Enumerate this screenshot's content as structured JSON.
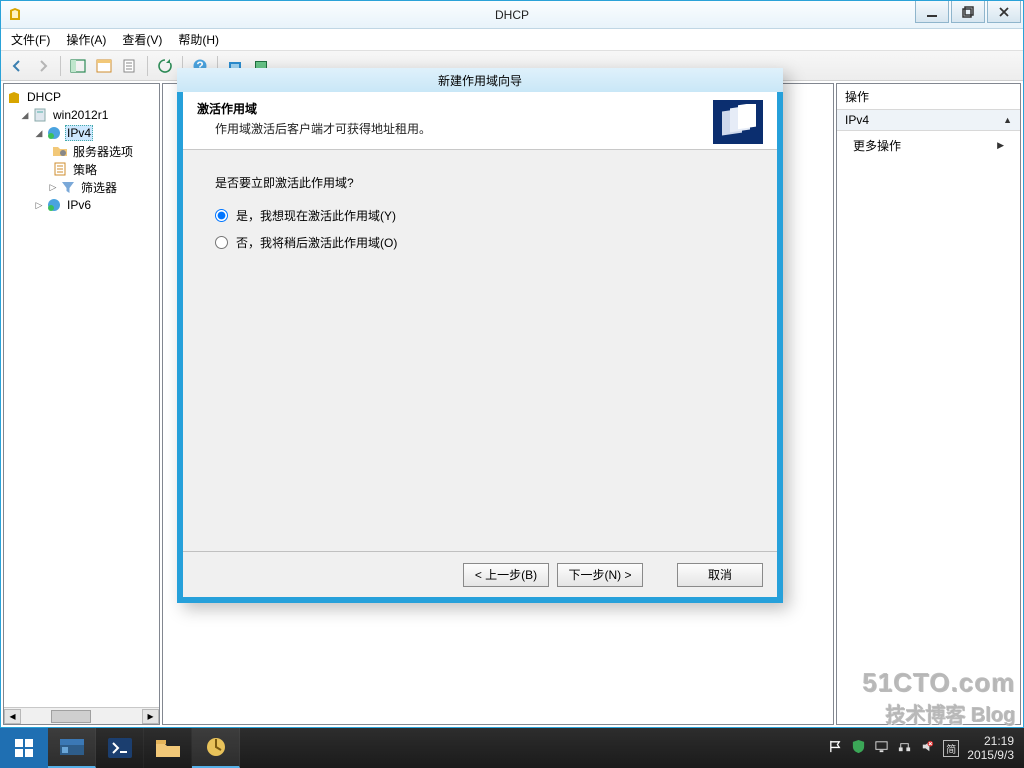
{
  "window": {
    "title": "DHCP"
  },
  "menubar": {
    "file": "文件(F)",
    "action": "操作(A)",
    "view": "查看(V)",
    "help": "帮助(H)"
  },
  "tree": {
    "root": "DHCP",
    "server": "win2012r1",
    "ipv4": "IPv4",
    "server_options": "服务器选项",
    "policy": "策略",
    "filter": "筛选器",
    "ipv6": "IPv6"
  },
  "actions": {
    "header": "操作",
    "band": "IPv4",
    "more": "更多操作"
  },
  "wizard": {
    "title": "新建作用域向导",
    "heading": "激活作用域",
    "subheading": "作用域激活后客户端才可获得地址租用。",
    "question": "是否要立即激活此作用域?",
    "opt_yes": "是，我想现在激活此作用域(Y)",
    "opt_no": "否，我将稍后激活此作用域(O)",
    "back": "< 上一步(B)",
    "next": "下一步(N) >",
    "cancel": "取消"
  },
  "tray": {
    "time": "21:19",
    "date": "2015/9/3"
  },
  "watermark": {
    "line1": "51CTO.com",
    "line2": "技术博客 Blog"
  }
}
